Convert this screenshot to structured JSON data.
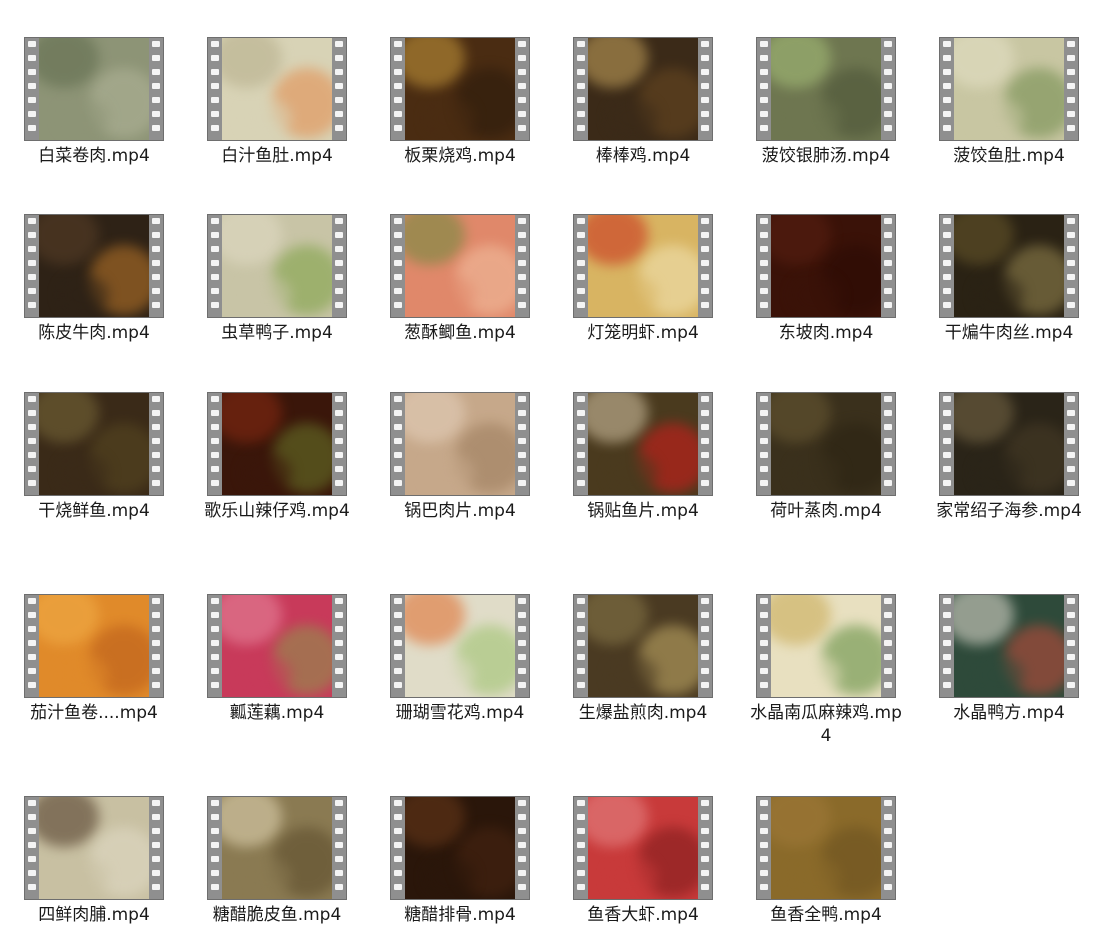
{
  "files": [
    {
      "name": "白菜卷肉.mp4",
      "colors": [
        "#8d9476",
        "#5e6a4c",
        "#b3b69a"
      ]
    },
    {
      "name": "白汁鱼肚.mp4",
      "colors": [
        "#d8d3b6",
        "#b5ad8a",
        "#e48a4a"
      ]
    },
    {
      "name": "板栗烧鸡.mp4",
      "colors": [
        "#4a2c12",
        "#c89a3c",
        "#2a1a0c"
      ]
    },
    {
      "name": "棒棒鸡.mp4",
      "colors": [
        "#3b2a18",
        "#c9a65e",
        "#6b4a22"
      ]
    },
    {
      "name": "菠饺银肺汤.mp4",
      "colors": [
        "#6e7650",
        "#a8c27a",
        "#4a5236"
      ]
    },
    {
      "name": "菠饺鱼肚.mp4",
      "colors": [
        "#c8c6a2",
        "#e6e2c8",
        "#6e8a4a"
      ]
    },
    {
      "name": "陈皮牛肉.mp4",
      "colors": [
        "#2e2216",
        "#5a4028",
        "#c07a2a"
      ]
    },
    {
      "name": "虫草鸭子.mp4",
      "colors": [
        "#c8c4a6",
        "#e2dcc6",
        "#7aa040"
      ]
    },
    {
      "name": "葱酥鲫鱼.mp4",
      "colors": [
        "#e0886a",
        "#6a8a3c",
        "#f2c2a2"
      ]
    },
    {
      "name": "灯笼明虾.mp4",
      "colors": [
        "#d8b462",
        "#c82a18",
        "#f2e6b8"
      ]
    },
    {
      "name": "东坡肉.mp4",
      "colors": [
        "#3a1208",
        "#5a2012",
        "#2a0a04"
      ]
    },
    {
      "name": "干煸牛肉丝.mp4",
      "colors": [
        "#2a2214",
        "#6a5a2c",
        "#9a8a52"
      ]
    },
    {
      "name": "干烧鲜鱼.mp4",
      "colors": [
        "#3a2a18",
        "#7a6a3a",
        "#5a4a22"
      ]
    },
    {
      "name": "歌乐山辣仔鸡.mp4",
      "colors": [
        "#3a160a",
        "#8a2a12",
        "#6a7a2a"
      ]
    },
    {
      "name": "锅巴肉片.mp4",
      "colors": [
        "#c6a88a",
        "#e6d2be",
        "#9a7a5a"
      ]
    },
    {
      "name": "锅贴鱼片.mp4",
      "colors": [
        "#4a3a1e",
        "#d8c8a8",
        "#d81a1a"
      ]
    },
    {
      "name": "荷叶蒸肉.mp4",
      "colors": [
        "#3a301c",
        "#6a5a34",
        "#2a2212"
      ]
    },
    {
      "name": "家常绍子海参.mp4",
      "colors": [
        "#2a2418",
        "#7a6a48",
        "#4a3e28"
      ]
    },
    {
      "name": "茄汁鱼卷....mp4",
      "colors": [
        "#e08a2a",
        "#f2b04a",
        "#b85a1a"
      ]
    },
    {
      "name": "瓤莲藕.mp4",
      "colors": [
        "#c83a5a",
        "#e88aa0",
        "#8a9a4a"
      ]
    },
    {
      "name": "珊瑚雪花鸡.mp4",
      "colors": [
        "#e0dcc8",
        "#e06a2a",
        "#9ac26a"
      ]
    },
    {
      "name": "生爆盐煎肉.mp4",
      "colors": [
        "#4a3a22",
        "#8a7a4a",
        "#c8b06a"
      ]
    },
    {
      "name": "水晶南瓜麻辣鸡.mp4",
      "colors": [
        "#e8e0c0",
        "#c8a850",
        "#5a8a3a"
      ]
    },
    {
      "name": "水晶鸭方.mp4",
      "colors": [
        "#2e4a3a",
        "#e8e2d6",
        "#c84a3a"
      ]
    },
    {
      "name": "四鲜肉脯.mp4",
      "colors": [
        "#c8c0a2",
        "#4a3422",
        "#e2dcc8"
      ]
    },
    {
      "name": "糖醋脆皮鱼.mp4",
      "colors": [
        "#8a7a52",
        "#e6dab8",
        "#5a4a2a"
      ]
    },
    {
      "name": "糖醋排骨.mp4",
      "colors": [
        "#2a160a",
        "#6a3a1a",
        "#4a2612"
      ]
    },
    {
      "name": "鱼香大虾.mp4",
      "colors": [
        "#c83a3a",
        "#e88a8a",
        "#7a1a1a"
      ]
    },
    {
      "name": "鱼香全鸭.mp4",
      "colors": [
        "#8a6a2a",
        "#a07a3a",
        "#6a5020"
      ]
    }
  ]
}
